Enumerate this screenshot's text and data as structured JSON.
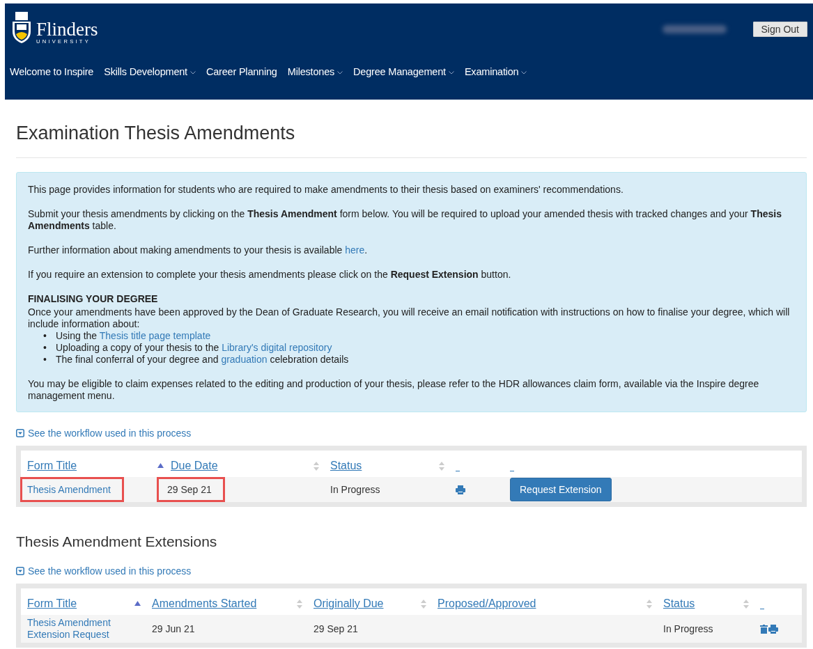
{
  "header": {
    "logo": {
      "name": "Flinders",
      "sub": "UNIVERSITY"
    },
    "user_name_blurred": true,
    "sign_out": "Sign Out",
    "nav": [
      {
        "label": "Welcome to Inspire",
        "dropdown": false
      },
      {
        "label": "Skills Development",
        "dropdown": true
      },
      {
        "label": "Career Planning",
        "dropdown": false
      },
      {
        "label": "Milestones",
        "dropdown": true
      },
      {
        "label": "Degree Management",
        "dropdown": true
      },
      {
        "label": "Examination",
        "dropdown": true
      }
    ]
  },
  "page_title": "Examination Thesis Amendments",
  "info": {
    "paragraphs_top": [
      "This page provides information for students who are required to make amendments to their thesis based on examiners' recommendations.",
      "Submit your thesis amendments by clicking on the **Thesis Amendment** form below. You will be required to upload your amended thesis with tracked changes and your **Thesis Amendments** table."
    ],
    "further": {
      "before": "Further information about making amendments to your thesis is available ",
      "link": "here",
      "after": "."
    },
    "extension": "If you require an extension to complete your thesis amendments please click on the **Request Extension** button.",
    "heading": "FINALISING YOUR DEGREE",
    "intro": "Once your amendments have been approved by the Dean of Graduate Research, you will receive an email notification with instructions on how to finalise your degree, which will include information about:",
    "bullets": [
      {
        "marker": "•",
        "before": "Using the ",
        "link": "Thesis title page template"
      },
      {
        "marker": "•",
        "before": "Uploading a copy of your thesis to the ",
        "link": "Library's digital repository"
      },
      {
        "marker": "•",
        "before": "The final conferral of your degree and ",
        "link": "graduation",
        "after": " celebration details"
      }
    ],
    "closing": "You may be eligible to claim expenses related to the editing and production of your thesis, please refer to the HDR allowances claim form, available via the Inspire degree management menu."
  },
  "workflow_link_1": "See the workflow used in this process",
  "table1": {
    "columns": [
      {
        "label": "Form Title",
        "sorted": true
      },
      {
        "label": "Due Date",
        "sorted": false
      },
      {
        "label": "Status",
        "sorted": false
      }
    ],
    "rows": [
      {
        "form_title": "Thesis Amendment",
        "due_date": "29 Sep 21",
        "status": "In Progress",
        "title_highlighted": true,
        "date_highlighted": true,
        "action": "Request Extension"
      }
    ]
  },
  "section2_title": "Thesis Amendment Extensions",
  "workflow_link_2": "See the workflow used in this process",
  "table2": {
    "columns": [
      {
        "label": "Form Title",
        "sorted": true
      },
      {
        "label": "Amendments Started",
        "sorted": false
      },
      {
        "label": "Originally Due",
        "sorted": false
      },
      {
        "label": "Proposed/Approved",
        "sorted": false
      },
      {
        "label": "Status",
        "sorted": false
      }
    ],
    "rows": [
      {
        "form_title": "Thesis Amendment Extension Request",
        "started": "29 Jun 21",
        "originally_due": "29 Sep 21",
        "status": "In Progress"
      }
    ]
  }
}
